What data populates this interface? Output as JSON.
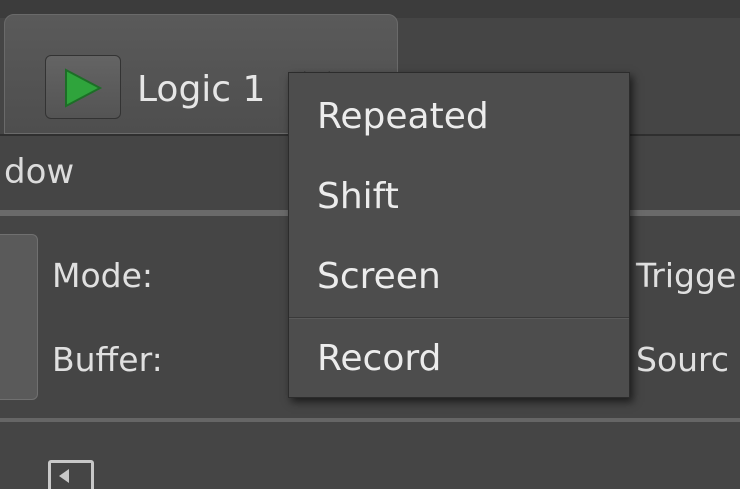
{
  "toolbar": {
    "logic_label": "Logic 1",
    "play_icon": "play-icon",
    "dropdown_icon": "chevron-down-icon"
  },
  "window_label": "dow",
  "fields": {
    "mode_label": "Mode:",
    "buffer_label": "Buffer:",
    "trigger_label": "Trigge",
    "source_label": "Sourc"
  },
  "dropdown_menu": {
    "items": [
      {
        "label": "Repeated"
      },
      {
        "label": "Shift"
      },
      {
        "label": "Screen"
      },
      {
        "label": "Record"
      }
    ]
  },
  "colors": {
    "background": "#454545",
    "menu_background": "#4d4d4d",
    "play_green": "#2fa43c",
    "text": "#e8e8e8"
  }
}
